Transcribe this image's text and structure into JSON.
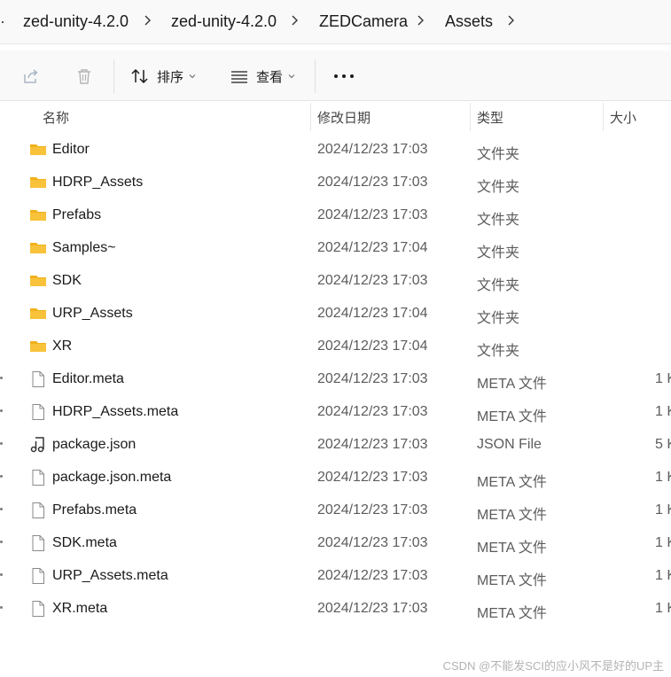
{
  "breadcrumb": {
    "items": [
      "zed-unity-4.2.0",
      "zed-unity-4.2.0",
      "ZEDCamera",
      "Assets"
    ]
  },
  "toolbar": {
    "share_icon": "share-icon",
    "delete_icon": "trash-icon",
    "sort_label": "排序",
    "view_label": "查看",
    "more_icon": "more-icon"
  },
  "columns": {
    "name": "名称",
    "modified": "修改日期",
    "type": "类型",
    "size": "大小"
  },
  "files": [
    {
      "name": "Editor",
      "date": "2024/12/23 17:03",
      "type": "文件夹",
      "size": "",
      "icon": "folder-icon"
    },
    {
      "name": "HDRP_Assets",
      "date": "2024/12/23 17:03",
      "type": "文件夹",
      "size": "",
      "icon": "folder-icon"
    },
    {
      "name": "Prefabs",
      "date": "2024/12/23 17:03",
      "type": "文件夹",
      "size": "",
      "icon": "folder-icon"
    },
    {
      "name": "Samples~",
      "date": "2024/12/23 17:04",
      "type": "文件夹",
      "size": "",
      "icon": "folder-icon"
    },
    {
      "name": "SDK",
      "date": "2024/12/23 17:03",
      "type": "文件夹",
      "size": "",
      "icon": "folder-icon"
    },
    {
      "name": "URP_Assets",
      "date": "2024/12/23 17:04",
      "type": "文件夹",
      "size": "",
      "icon": "folder-icon"
    },
    {
      "name": "XR",
      "date": "2024/12/23 17:04",
      "type": "文件夹",
      "size": "",
      "icon": "folder-icon"
    },
    {
      "name": "Editor.meta",
      "date": "2024/12/23 17:03",
      "type": "META 文件",
      "size": "1 K",
      "icon": "file-icon"
    },
    {
      "name": "HDRP_Assets.meta",
      "date": "2024/12/23 17:03",
      "type": "META 文件",
      "size": "1 K",
      "icon": "file-icon"
    },
    {
      "name": "package.json",
      "date": "2024/12/23 17:03",
      "type": "JSON File",
      "size": "5 K",
      "icon": "json-file-icon"
    },
    {
      "name": "package.json.meta",
      "date": "2024/12/23 17:03",
      "type": "META 文件",
      "size": "1 K",
      "icon": "file-icon"
    },
    {
      "name": "Prefabs.meta",
      "date": "2024/12/23 17:03",
      "type": "META 文件",
      "size": "1 K",
      "icon": "file-icon"
    },
    {
      "name": "SDK.meta",
      "date": "2024/12/23 17:03",
      "type": "META 文件",
      "size": "1 K",
      "icon": "file-icon"
    },
    {
      "name": "URP_Assets.meta",
      "date": "2024/12/23 17:03",
      "type": "META 文件",
      "size": "1 K",
      "icon": "file-icon"
    },
    {
      "name": "XR.meta",
      "date": "2024/12/23 17:03",
      "type": "META 文件",
      "size": "1 K",
      "icon": "file-icon"
    }
  ],
  "watermark": "CSDN @不能发SCI的应小风不是好的UP主",
  "colors": {
    "folder": "#f8c23a",
    "folder_tab": "#f0b21c",
    "toolbar_bg": "#f9f9f9",
    "text_secondary": "#5c5c5c"
  }
}
